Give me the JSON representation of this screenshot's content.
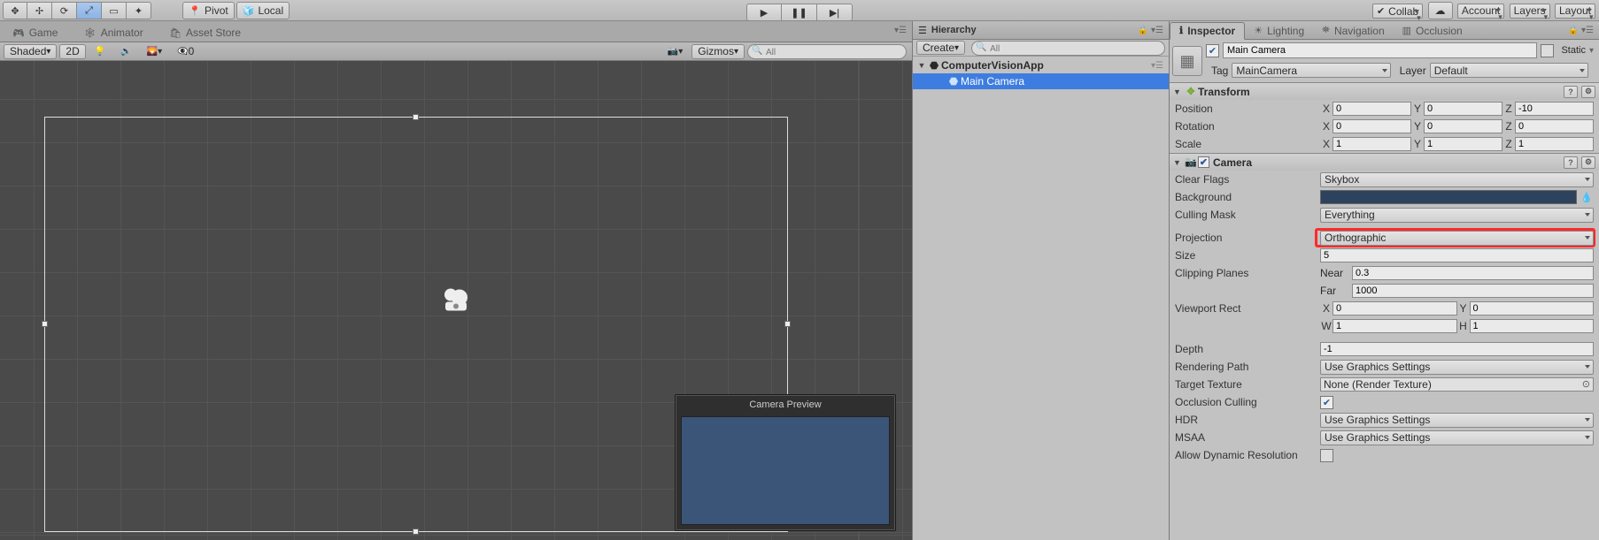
{
  "topbar": {
    "pivot": "Pivot",
    "local": "Local",
    "collab": "Collab",
    "account": "Account",
    "layers": "Layers",
    "layout": "Layout"
  },
  "tabs": {
    "game": "Game",
    "animator": "Animator",
    "assetstore": "Asset Store"
  },
  "scene": {
    "shaded": "Shaded",
    "twoD": "2D",
    "gizmos": "Gizmos",
    "search_placeholder": "All",
    "preview_title": "Camera Preview",
    "zero": "0"
  },
  "hierarchy": {
    "title": "Hierarchy",
    "create": "Create",
    "search_placeholder": "All",
    "root": "ComputerVisionApp",
    "child1": "Main Camera"
  },
  "inspector_tabs": {
    "inspector": "Inspector",
    "lighting": "Lighting",
    "navigation": "Navigation",
    "occlusion": "Occlusion"
  },
  "inspector": {
    "name": "Main Camera",
    "static": "Static",
    "tag_label": "Tag",
    "tag_value": "MainCamera",
    "layer_label": "Layer",
    "layer_value": "Default",
    "transform": {
      "title": "Transform",
      "position_lbl": "Position",
      "rotation_lbl": "Rotation",
      "scale_lbl": "Scale",
      "position": {
        "x": "0",
        "y": "0",
        "z": "-10"
      },
      "rotation": {
        "x": "0",
        "y": "0",
        "z": "0"
      },
      "scale": {
        "x": "1",
        "y": "1",
        "z": "1"
      }
    },
    "camera": {
      "title": "Camera",
      "clear_flags_lbl": "Clear Flags",
      "clear_flags": "Skybox",
      "background_lbl": "Background",
      "background_color": "#2d425d",
      "culling_mask_lbl": "Culling Mask",
      "culling_mask": "Everything",
      "projection_lbl": "Projection",
      "projection": "Orthographic",
      "size_lbl": "Size",
      "size": "5",
      "clipping_lbl": "Clipping Planes",
      "near_lbl": "Near",
      "near": "0.3",
      "far_lbl": "Far",
      "far": "1000",
      "viewport_lbl": "Viewport Rect",
      "viewport": {
        "x": "0",
        "y": "0",
        "w": "1",
        "h": "1"
      },
      "depth_lbl": "Depth",
      "depth": "-1",
      "rendering_path_lbl": "Rendering Path",
      "rendering_path": "Use Graphics Settings",
      "target_texture_lbl": "Target Texture",
      "target_texture": "None (Render Texture)",
      "occlusion_culling_lbl": "Occlusion Culling",
      "hdr_lbl": "HDR",
      "hdr": "Use Graphics Settings",
      "msaa_lbl": "MSAA",
      "msaa": "Use Graphics Settings",
      "dyn_res_lbl": "Allow Dynamic Resolution"
    }
  }
}
